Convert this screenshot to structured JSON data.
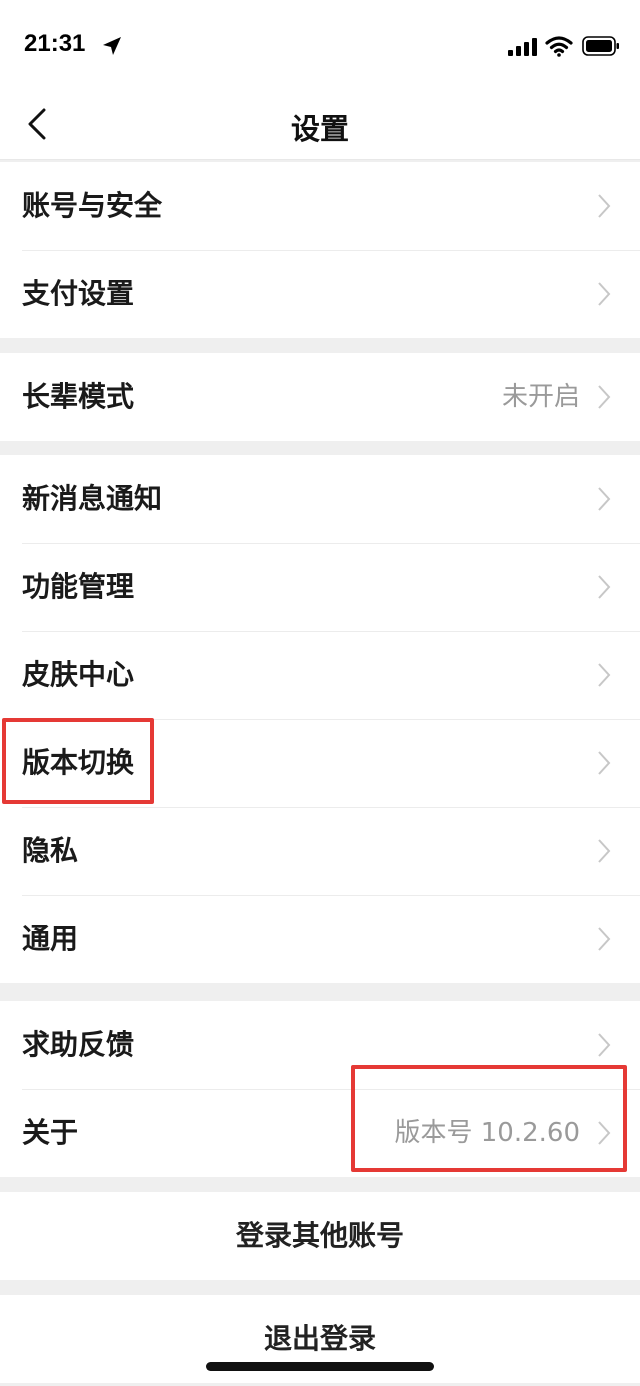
{
  "status_bar": {
    "time": "21:31",
    "icons": [
      "location-arrow-icon",
      "signal-icon",
      "wifi-icon",
      "battery-icon"
    ]
  },
  "nav": {
    "title": "设置",
    "back_icon": "chevron-left-icon"
  },
  "groups": [
    {
      "items": [
        {
          "label": "账号与安全"
        },
        {
          "label": "支付设置"
        }
      ]
    },
    {
      "items": [
        {
          "label": "长辈模式",
          "value": "未开启"
        }
      ]
    },
    {
      "items": [
        {
          "label": "新消息通知"
        },
        {
          "label": "功能管理"
        },
        {
          "label": "皮肤中心"
        },
        {
          "label": "版本切换"
        },
        {
          "label": "隐私"
        },
        {
          "label": "通用"
        }
      ]
    },
    {
      "items": [
        {
          "label": "求助反馈"
        },
        {
          "label": "关于",
          "value": "版本号 10.2.60"
        }
      ]
    }
  ],
  "actions": {
    "switch_account": "登录其他账号",
    "logout": "退出登录"
  },
  "colors": {
    "highlight": "#e53935",
    "background": "#efefef",
    "secondary_text": "#9a9a9a"
  }
}
